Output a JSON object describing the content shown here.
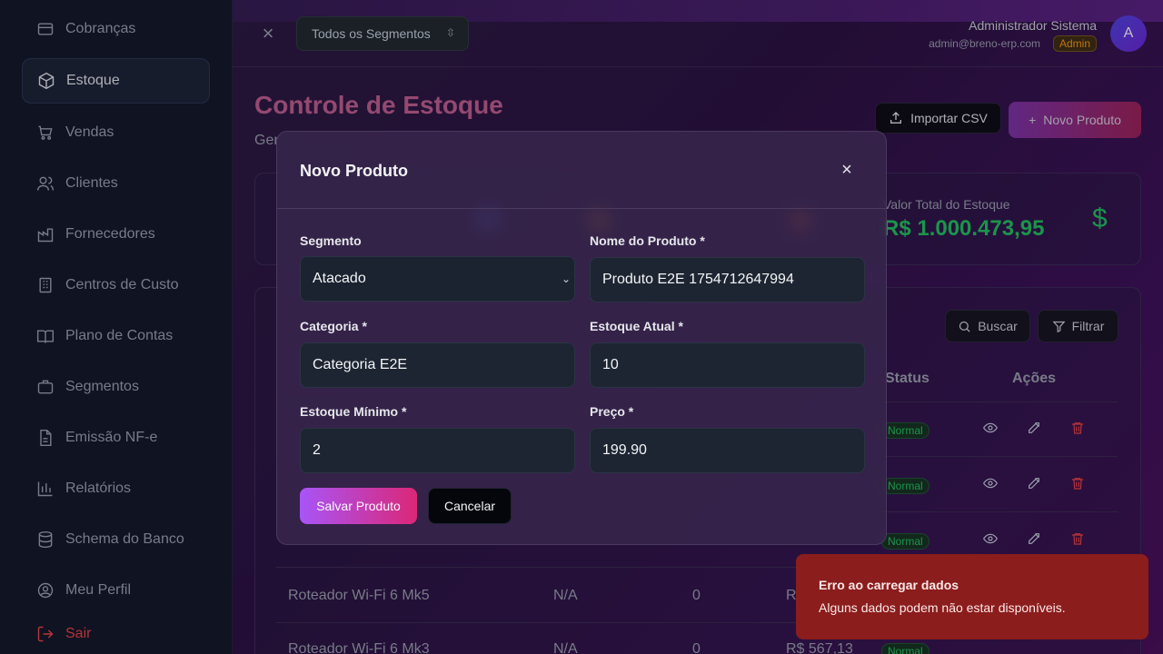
{
  "sidebar": {
    "items": [
      {
        "label": "Cobranças",
        "icon": "card-icon"
      },
      {
        "label": "Estoque",
        "icon": "package-icon",
        "active": true
      },
      {
        "label": "Vendas",
        "icon": "cart-icon"
      },
      {
        "label": "Clientes",
        "icon": "users-icon"
      },
      {
        "label": "Fornecedores",
        "icon": "factory-icon"
      },
      {
        "label": "Centros de Custo",
        "icon": "building-icon"
      },
      {
        "label": "Plano de Contas",
        "icon": "book-icon"
      },
      {
        "label": "Segmentos",
        "icon": "briefcase-icon"
      },
      {
        "label": "Emissão NF-e",
        "icon": "file-icon"
      },
      {
        "label": "Relatórios",
        "icon": "bar-chart-icon"
      },
      {
        "label": "Schema do Banco",
        "icon": "database-icon"
      },
      {
        "label": "Meu Perfil",
        "icon": "user-circle-icon"
      },
      {
        "label": "Sair",
        "icon": "logout-icon"
      }
    ]
  },
  "header": {
    "segment_select": "Todos os Segmentos",
    "user_name": "Administrador Sistema",
    "user_email": "admin@breno-erp.com",
    "user_role": "Admin",
    "avatar_initial": "A"
  },
  "page": {
    "title": "Controle de Estoque",
    "subtitle_visible": "Ger",
    "import_button": "Importar CSV",
    "new_button": "Novo Produto"
  },
  "stats": {
    "total_label": "Valor Total do Estoque",
    "total_value": "R$ 1.000.473,95",
    "currency_icon": "$"
  },
  "table": {
    "search_button": "Buscar",
    "filter_button": "Filtrar",
    "headers": {
      "status": "Status",
      "actions": "Ações"
    },
    "rows": [
      {
        "status": "Normal"
      },
      {
        "status": "Normal"
      },
      {
        "status": "Normal"
      },
      {
        "name": "Roteador Wi-Fi 6 Mk5",
        "category": "N/A",
        "stock": "0",
        "price": "R"
      },
      {
        "name": "Roteador Wi-Fi 6 Mk3",
        "category": "N/A",
        "stock": "0",
        "price": "R$ 567,13",
        "status": "Normal"
      }
    ]
  },
  "modal": {
    "title": "Novo Produto",
    "fields": {
      "segmento": {
        "label": "Segmento",
        "value": "Atacado"
      },
      "nome": {
        "label": "Nome do Produto *",
        "value": "Produto E2E 1754712647994"
      },
      "categoria": {
        "label": "Categoria *",
        "value": "Categoria E2E"
      },
      "estoque_atual": {
        "label": "Estoque Atual *",
        "value": "10"
      },
      "estoque_minimo": {
        "label": "Estoque Mínimo *",
        "value": "2"
      },
      "preco": {
        "label": "Preço *",
        "value": "199.90"
      }
    },
    "save_button": "Salvar Produto",
    "cancel_button": "Cancelar"
  },
  "toast": {
    "title": "Erro ao carregar dados",
    "message": "Alguns dados podem não estar disponíveis."
  },
  "colors": {
    "accent_pink": "#db2777",
    "accent_purple": "#a855f7",
    "success": "#22c55e",
    "danger": "#ef4444",
    "toast_bg": "#8b1d1d"
  }
}
